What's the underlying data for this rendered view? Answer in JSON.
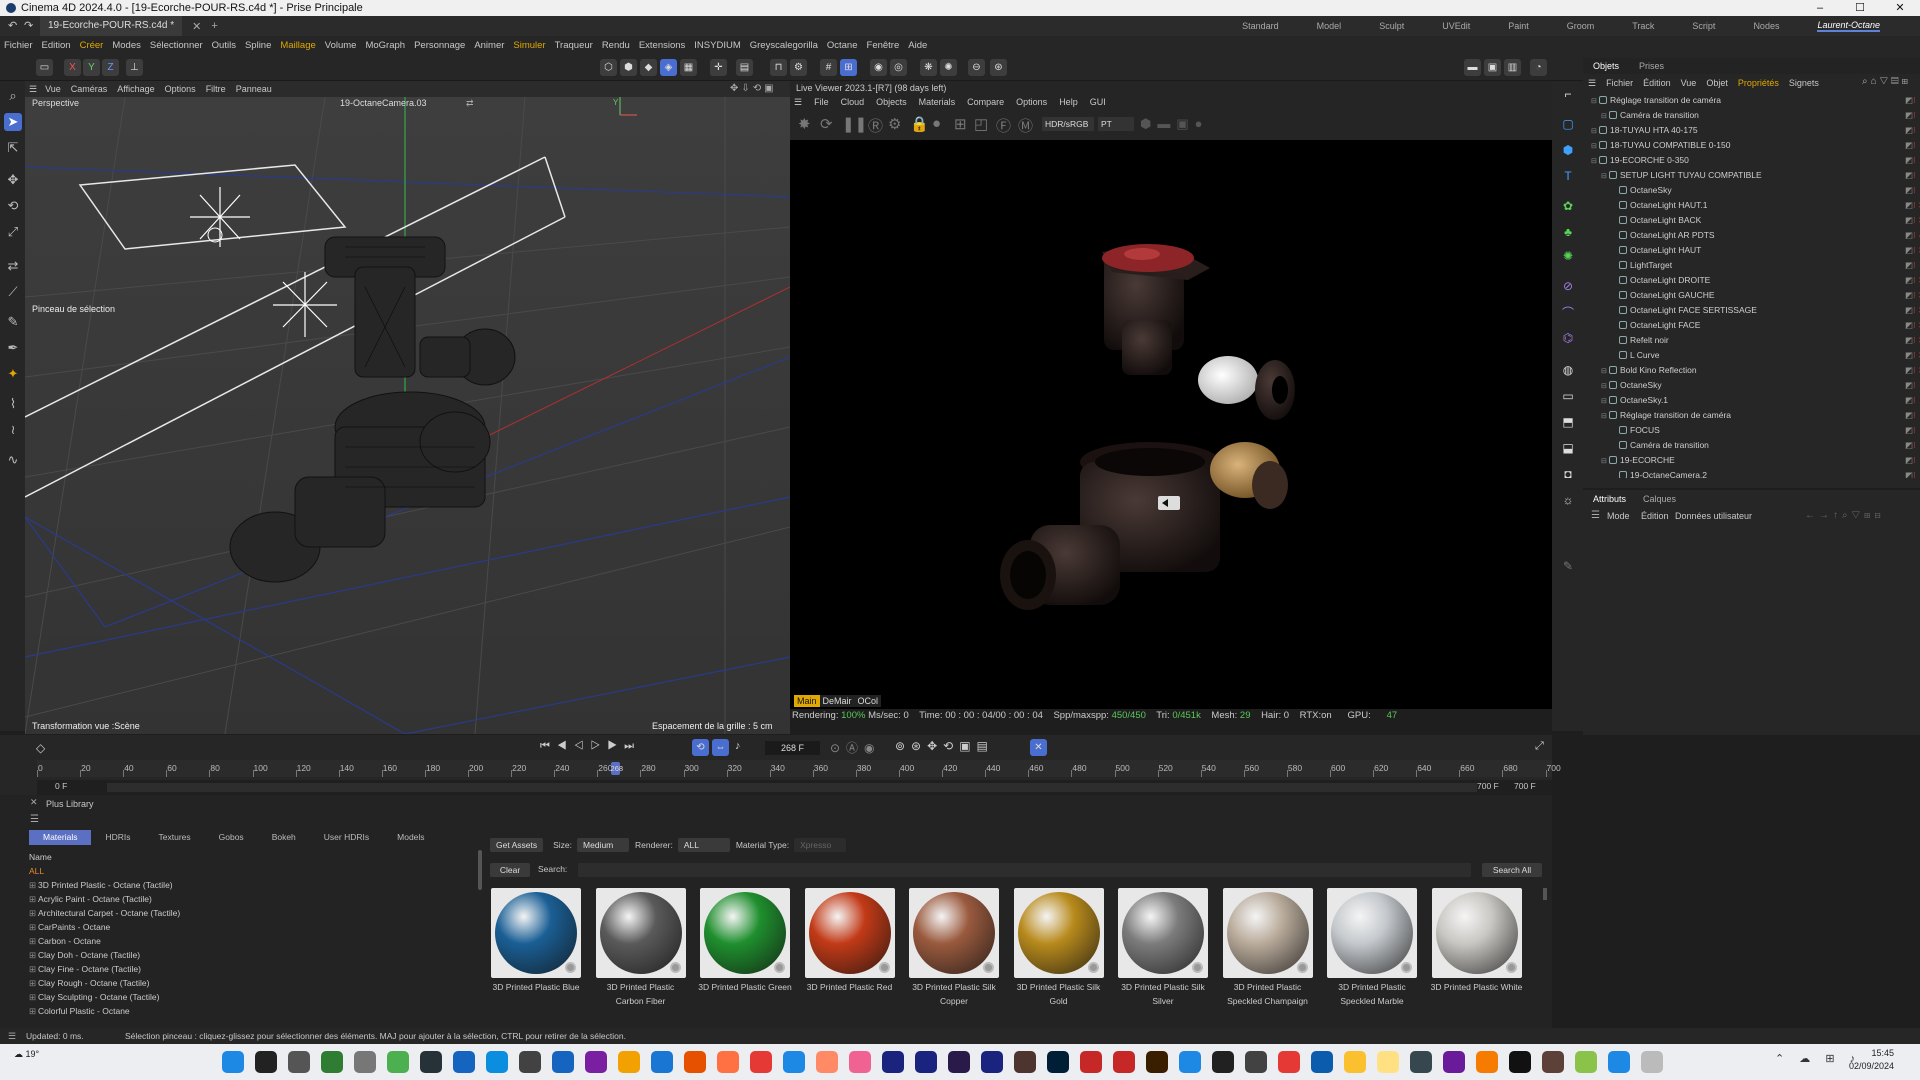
{
  "window": {
    "title": "Cinema 4D 2024.4.0 - [19-Ecorche-POUR-RS.c4d *] - Prise Principale",
    "minimize": "–",
    "maximize": "☐",
    "close": "✕"
  },
  "doc_tab": "19-Ecorche-POUR-RS.c4d *",
  "layouts": [
    "Standard",
    "Model",
    "Sculpt",
    "UVEdit",
    "Paint",
    "Groom",
    "Track",
    "Script",
    "Nodes",
    "Laurent-Octane"
  ],
  "menu": [
    "Fichier",
    "Edition",
    "Créer",
    "Modes",
    "Sélectionner",
    "Outils",
    "Spline",
    "Maillage",
    "Volume",
    "MoGraph",
    "Personnage",
    "Animer",
    "Simuler",
    "Traqueur",
    "Rendu",
    "Extensions",
    "INSYDIUM",
    "Greyscalegorilla",
    "Octane",
    "Fenêtre",
    "Aide"
  ],
  "viewport": {
    "menu": [
      "Vue",
      "Caméras",
      "Affichage",
      "Options",
      "Filtre",
      "Panneau"
    ],
    "name": "Perspective",
    "camera": "19-OctaneCamera.03",
    "brush_label": "Pinceau de sélection",
    "footer_left": "Transformation vue :Scène",
    "footer_right": "Espacement de la grille : 5 cm"
  },
  "live_viewer": {
    "title": "Live Viewer 2023.1-[R7] (98 days left)",
    "menu": [
      "File",
      "Cloud",
      "Objects",
      "Materials",
      "Compare",
      "Options",
      "Help",
      "GUI"
    ],
    "color_space": "HDR/sRGB",
    "pass": "PT",
    "badges": [
      "Main",
      "DeMair",
      "OCol"
    ],
    "status": {
      "rendering_label": "Rendering:",
      "rendering": "100%",
      "ms_label": "Ms/sec:",
      "ms": "0",
      "time_label": "Time:",
      "time": "00 : 00 : 04/00 : 00 : 04",
      "spp_label": "Spp/maxspp:",
      "spp": "450/450",
      "tri_label": "Tri:",
      "tri": "0/451k",
      "mesh_label": "Mesh:",
      "mesh": "29",
      "hair_label": "Hair:",
      "hair": "0",
      "rtx_label": "RTX:",
      "rtx": "on",
      "gpu_label": "GPU:",
      "gpu": "47"
    }
  },
  "objects_panel": {
    "tabs": [
      "Objets",
      "Prises"
    ],
    "menu": [
      "Fichier",
      "Édition",
      "Vue",
      "Objet",
      "Propriétés",
      "Signets"
    ],
    "rows": [
      {
        "label": "Réglage transition de caméra",
        "indent": 0
      },
      {
        "label": "Caméra de transition",
        "indent": 1
      },
      {
        "label": "18-TUYAU HTA 40-175",
        "indent": 0
      },
      {
        "label": "18-TUYAU COMPATIBLE 0-150",
        "indent": 0
      },
      {
        "label": "19-ECORCHE 0-350",
        "indent": 0
      },
      {
        "label": "SETUP LIGHT TUYAU COMPATIBLE",
        "indent": 1
      },
      {
        "label": "OctaneSky",
        "indent": 2
      },
      {
        "label": "OctaneLight HAUT.1",
        "indent": 2
      },
      {
        "label": "OctaneLight BACK",
        "indent": 2
      },
      {
        "label": "OctaneLight AR PDTS",
        "indent": 2
      },
      {
        "label": "OctaneLight HAUT",
        "indent": 2
      },
      {
        "label": "LightTarget",
        "indent": 2
      },
      {
        "label": "OctaneLight DROITE",
        "indent": 2
      },
      {
        "label": "OctaneLight GAUCHE",
        "indent": 2
      },
      {
        "label": "OctaneLight FACE SERTISSAGE",
        "indent": 2
      },
      {
        "label": "OctaneLight FACE",
        "indent": 2
      },
      {
        "label": "Refelt noir",
        "indent": 2
      },
      {
        "label": "L Curve",
        "indent": 2
      },
      {
        "label": "Bold Kino Reflection",
        "indent": 1
      },
      {
        "label": "OctaneSky",
        "indent": 1
      },
      {
        "label": "OctaneSky.1",
        "indent": 1
      },
      {
        "label": "Réglage transition de caméra",
        "indent": 1
      },
      {
        "label": "FOCUS",
        "indent": 2
      },
      {
        "label": "Caméra de transition",
        "indent": 2
      },
      {
        "label": "19-ECORCHE",
        "indent": 1
      },
      {
        "label": "19-OctaneCamera.2",
        "indent": 2
      }
    ]
  },
  "attributes_panel": {
    "tabs": [
      "Attributs",
      "Calques"
    ],
    "menu": [
      "Mode",
      "Édition",
      "Données utilisateur"
    ]
  },
  "timeline": {
    "frame": "268 F",
    "ticks": [
      "0",
      "20",
      "40",
      "60",
      "80",
      "100",
      "120",
      "140",
      "160",
      "180",
      "200",
      "220",
      "240",
      "260",
      "280",
      "300",
      "320",
      "340",
      "360",
      "380",
      "400",
      "420",
      "440",
      "460",
      "480",
      "500",
      "520",
      "540",
      "560",
      "580",
      "600",
      "620",
      "640",
      "660",
      "680",
      "700"
    ],
    "current_tick": "268",
    "range_start": "0 F",
    "range_start2": "0 F",
    "range_end": "700 F",
    "range_end2": "700 F"
  },
  "plus_library": {
    "title": "Plus Library",
    "tabs": [
      "Materials",
      "HDRIs",
      "Textures",
      "Gobos",
      "Bokeh",
      "User HDRIs",
      "Models"
    ],
    "name_header": "Name",
    "all_label": "ALL",
    "categories": [
      "3D Printed Plastic - Octane (Tactile)",
      "Acrylic Paint - Octane (Tactile)",
      "Architectural Carpet - Octane (Tactile)",
      "CarPaints - Octane",
      "Carbon - Octane",
      "Clay Doh - Octane (Tactile)",
      "Clay Fine - Octane (Tactile)",
      "Clay Rough - Octane (Tactile)",
      "Clay Sculpting - Octane (Tactile)",
      "Colorful Plastic - Octane"
    ],
    "get_assets": "Get Assets",
    "size_label": "Size:",
    "size": "Medium",
    "renderer_label": "Renderer:",
    "renderer": "ALL",
    "material_type_label": "Material Type:",
    "material_type": "Xpresso",
    "clear": "Clear",
    "search_label": "Search:",
    "search_all": "Search All",
    "materials": [
      {
        "l1": "3D Printed Plastic Blue",
        "l2": "",
        "color": "#1a5f95"
      },
      {
        "l1": "3D Printed Plastic",
        "l2": "Carbon Fiber",
        "color": "#5a5a5a"
      },
      {
        "l1": "3D Printed Plastic Green",
        "l2": "",
        "color": "#1f8f2e"
      },
      {
        "l1": "3D Printed Plastic Red",
        "l2": "",
        "color": "#c23a17"
      },
      {
        "l1": "3D Printed Plastic Silk",
        "l2": "Copper",
        "color": "#9a5a3e"
      },
      {
        "l1": "3D Printed Plastic Silk",
        "l2": "Gold",
        "color": "#b88a1c"
      },
      {
        "l1": "3D Printed Plastic Silk",
        "l2": "Silver",
        "color": "#7c7c7c"
      },
      {
        "l1": "3D Printed Plastic",
        "l2": "Speckled Champaign",
        "color": "#b9ab9b"
      },
      {
        "l1": "3D Printed Plastic",
        "l2": "Speckled Marble",
        "color": "#c4c8cc"
      },
      {
        "l1": "3D Printed Plastic White",
        "l2": "",
        "color": "#c9c7c3"
      }
    ]
  },
  "status": {
    "updated": "Updated: 0 ms.",
    "hint": "Sélection pinceau : cliquez-glissez pour sélectionner des éléments. MAJ pour ajouter à la sélection, CTRL pour retirer de la sélection."
  },
  "taskbar": {
    "weather": "19°",
    "time": "15:45",
    "date": "02/09/2024"
  }
}
